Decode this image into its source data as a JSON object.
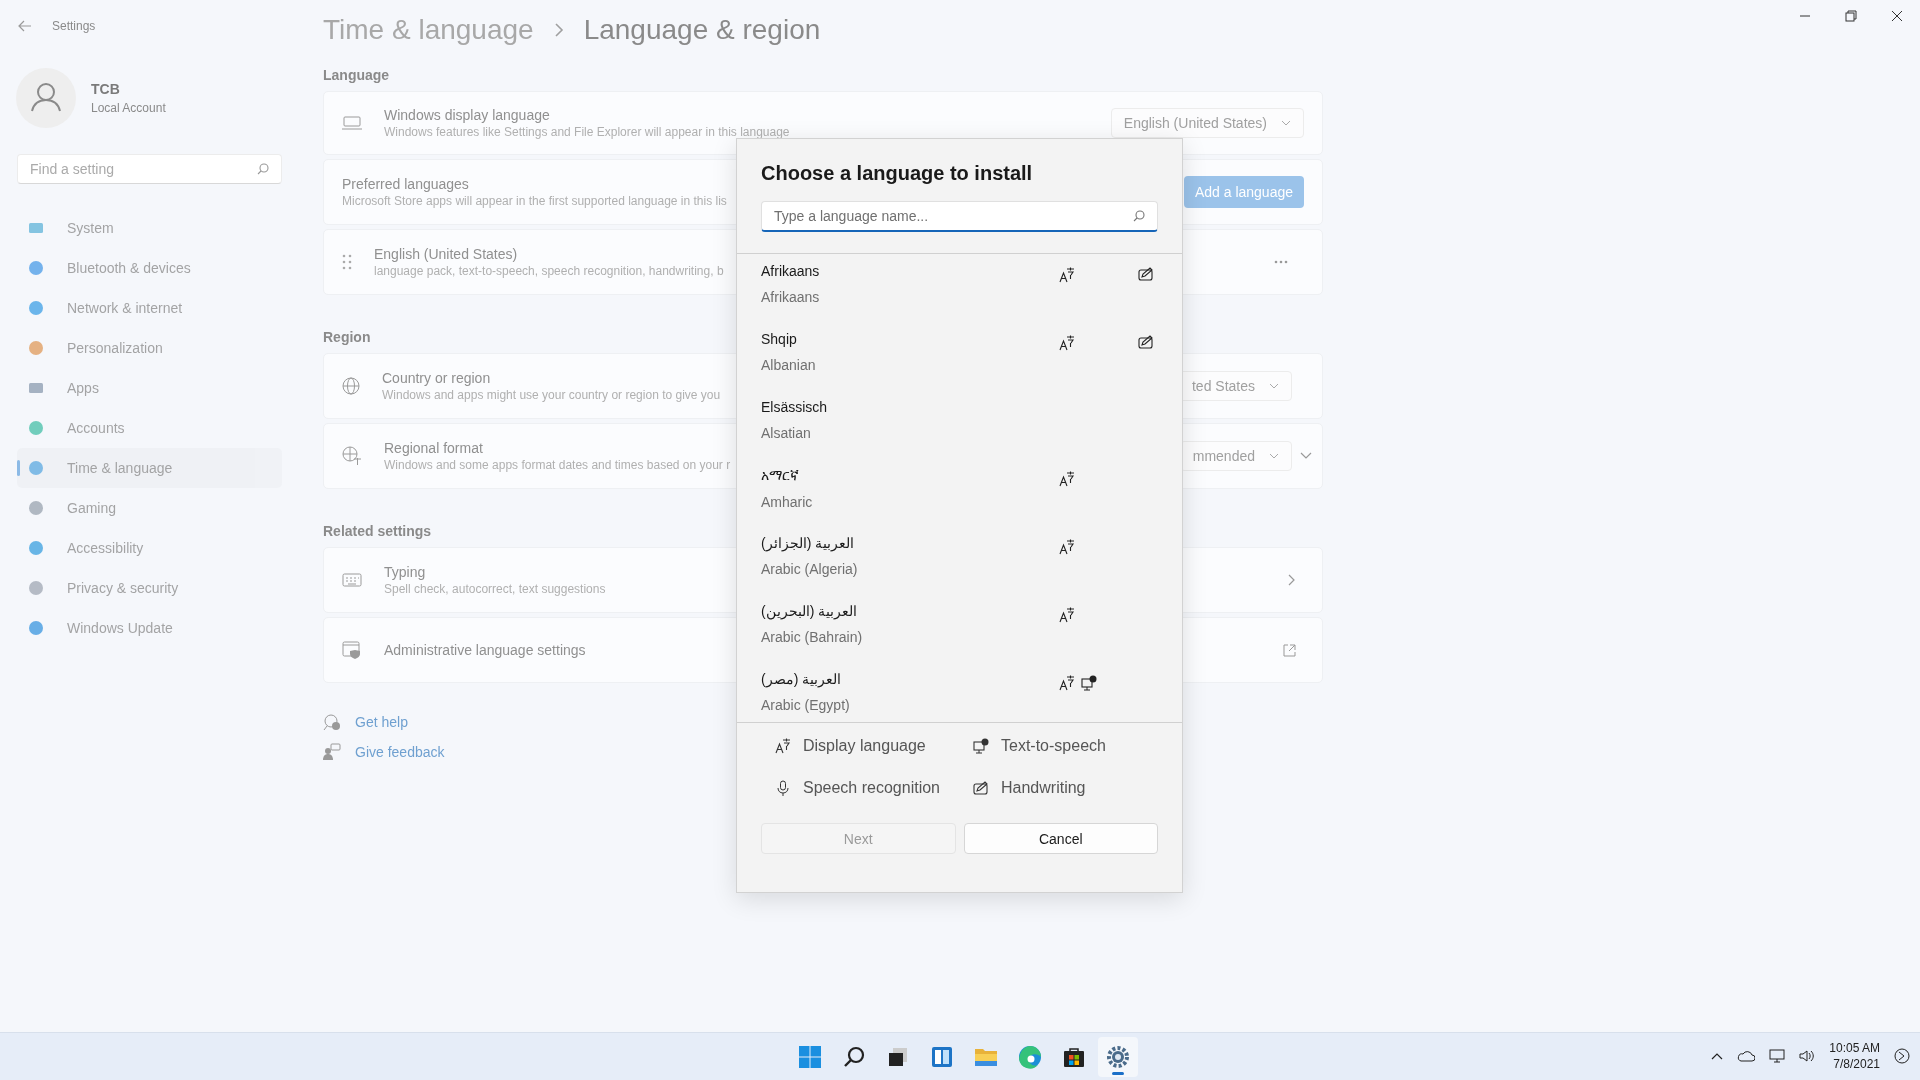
{
  "window": {
    "app_title": "Settings"
  },
  "account": {
    "name": "TCB",
    "type": "Local Account"
  },
  "search": {
    "placeholder": "Find a setting"
  },
  "nav": [
    {
      "label": "System",
      "selected": false
    },
    {
      "label": "Bluetooth & devices",
      "selected": false
    },
    {
      "label": "Network & internet",
      "selected": false
    },
    {
      "label": "Personalization",
      "selected": false
    },
    {
      "label": "Apps",
      "selected": false
    },
    {
      "label": "Accounts",
      "selected": false
    },
    {
      "label": "Time & language",
      "selected": true
    },
    {
      "label": "Gaming",
      "selected": false
    },
    {
      "label": "Accessibility",
      "selected": false
    },
    {
      "label": "Privacy & security",
      "selected": false
    },
    {
      "label": "Windows Update",
      "selected": false
    }
  ],
  "breadcrumb": {
    "parent": "Time & language",
    "current": "Language & region"
  },
  "language": {
    "heading": "Language",
    "display": {
      "title": "Windows display language",
      "description": "Windows features like Settings and File Explorer will appear in this language",
      "value": "English (United States)"
    },
    "preferred": {
      "title": "Preferred languages",
      "description": "Microsoft Store apps will appear in the first supported language in this lis",
      "button": "Add a language"
    },
    "installed": [
      {
        "title": "English (United States)",
        "description": "language pack, text-to-speech, speech recognition, handwriting, b"
      }
    ]
  },
  "region": {
    "heading": "Region",
    "rows": [
      {
        "kind": "dropdown",
        "title": "Country or region",
        "description": "Windows and apps might use your country or region to give you",
        "value": "ted States"
      },
      {
        "kind": "expander",
        "title": "Regional format",
        "description": "Windows and some apps format dates and times based on your r",
        "value": "mmended"
      }
    ]
  },
  "related": {
    "heading": "Related settings",
    "rows": [
      {
        "kind": "chevron",
        "title": "Typing",
        "description": "Spell check, autocorrect, text suggestions"
      },
      {
        "kind": "external",
        "title": "Administrative language settings"
      }
    ]
  },
  "help_links": [
    {
      "kind": "help",
      "label": "Get help"
    },
    {
      "kind": "feedback",
      "label": "Give feedback"
    }
  ],
  "dialog": {
    "title": "Choose a language to install",
    "search": {
      "placeholder": "Type a language name..."
    },
    "languages": [
      {
        "native": "Afrikaans",
        "english": "Afrikaans",
        "display": true,
        "tts": false,
        "handwriting": true
      },
      {
        "native": "Shqip",
        "english": "Albanian",
        "display": true,
        "tts": false,
        "handwriting": true
      },
      {
        "native": "Elsässisch",
        "english": "Alsatian",
        "display": false,
        "tts": false,
        "handwriting": false
      },
      {
        "native": "አማርኛ",
        "english": "Amharic",
        "display": true,
        "tts": false,
        "handwriting": false
      },
      {
        "native": "العربية (الجزائر)",
        "english": "Arabic (Algeria)",
        "display": true,
        "tts": false,
        "handwriting": false
      },
      {
        "native": "العربية (البحرين)",
        "english": "Arabic (Bahrain)",
        "display": true,
        "tts": false,
        "handwriting": false
      },
      {
        "native": "العربية (مصر)",
        "english": "Arabic (Egypt)",
        "display": true,
        "tts": true,
        "handwriting": false
      }
    ],
    "legend": [
      {
        "kind": "display",
        "label": "Display language"
      },
      {
        "kind": "tts",
        "label": "Text-to-speech"
      },
      {
        "kind": "speech",
        "label": "Speech recognition"
      },
      {
        "kind": "handwriting",
        "label": "Handwriting"
      }
    ],
    "buttons": [
      {
        "label": "Next",
        "disabled": true
      },
      {
        "label": "Cancel",
        "disabled": false
      }
    ]
  },
  "taskbar": {
    "apps": [
      {
        "kind": "start",
        "selected": false
      },
      {
        "kind": "search",
        "selected": false
      },
      {
        "kind": "taskview",
        "selected": false
      },
      {
        "kind": "widgets",
        "selected": false
      },
      {
        "kind": "explorer",
        "selected": false
      },
      {
        "kind": "edge",
        "selected": false
      },
      {
        "kind": "store",
        "selected": false
      },
      {
        "kind": "settings",
        "selected": true
      }
    ],
    "time": "10:05 AM",
    "date": "7/8/2021"
  }
}
